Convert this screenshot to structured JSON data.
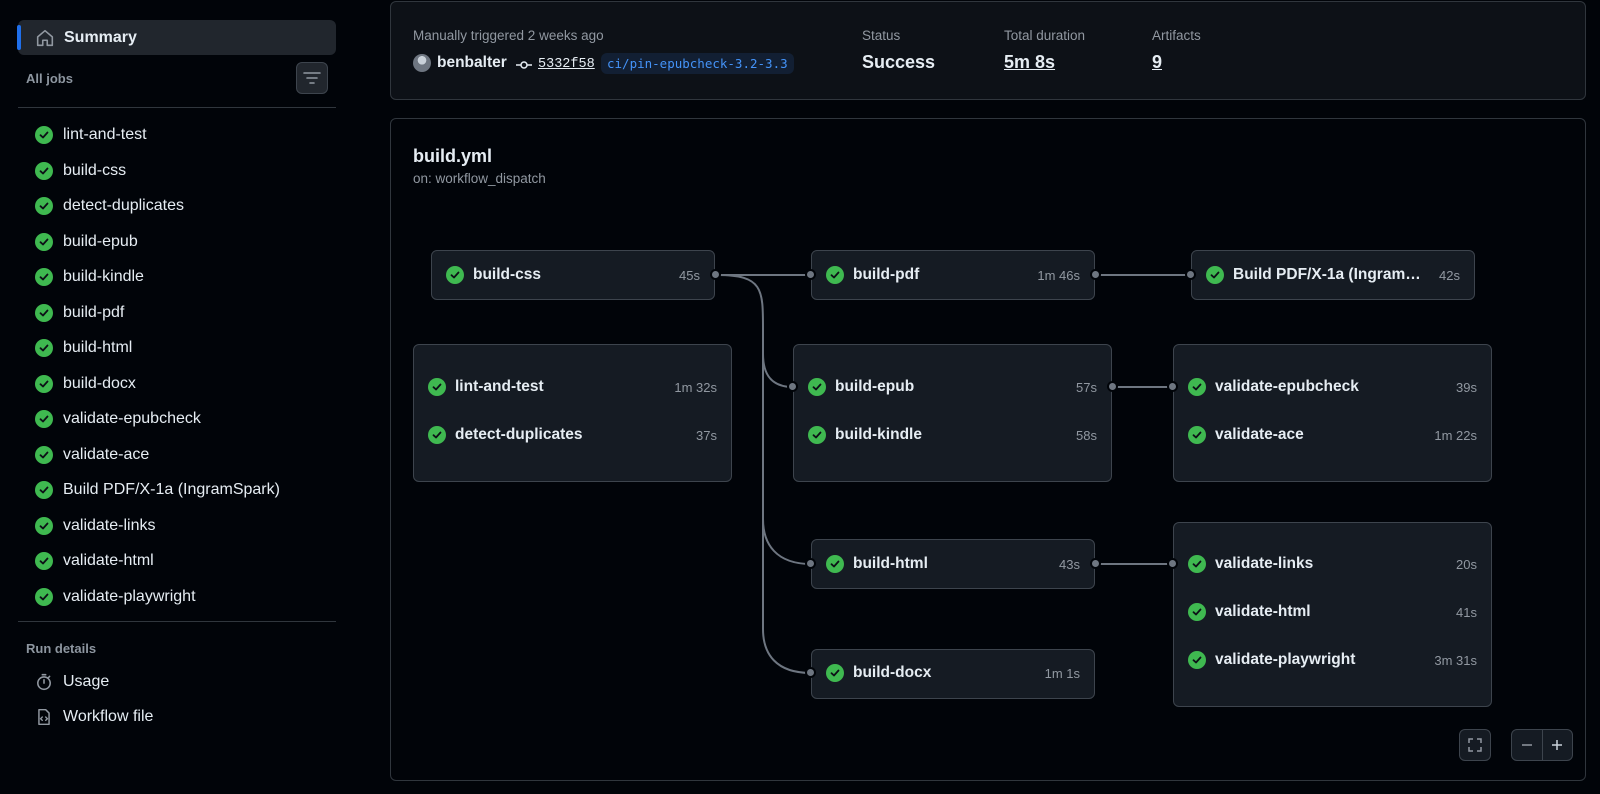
{
  "sidebar": {
    "summary_label": "Summary",
    "all_jobs_label": "All jobs",
    "jobs": [
      "lint-and-test",
      "build-css",
      "detect-duplicates",
      "build-epub",
      "build-kindle",
      "build-pdf",
      "build-html",
      "build-docx",
      "validate-epubcheck",
      "validate-ace",
      "Build PDF/X-1a (IngramSpark)",
      "validate-links",
      "validate-html",
      "validate-playwright"
    ],
    "run_details_label": "Run details",
    "usage_label": "Usage",
    "workflow_file_label": "Workflow file"
  },
  "header": {
    "trigger_text": "Manually triggered 2 weeks ago",
    "actor": "benbalter",
    "commit_sha": "5332f58",
    "branch": "ci/pin-epubcheck-3.2-3.3",
    "status_label": "Status",
    "status_value": "Success",
    "duration_label": "Total duration",
    "duration_value": "5m 8s",
    "artifacts_label": "Artifacts",
    "artifacts_value": "9"
  },
  "workflow": {
    "file": "build.yml",
    "trigger": "on: workflow_dispatch",
    "nodes": {
      "build_css": [
        {
          "name": "build-css",
          "duration": "45s"
        }
      ],
      "lint_group": [
        {
          "name": "lint-and-test",
          "duration": "1m 32s"
        },
        {
          "name": "detect-duplicates",
          "duration": "37s"
        }
      ],
      "build_pdf": [
        {
          "name": "build-pdf",
          "duration": "1m 46s"
        }
      ],
      "epub_group": [
        {
          "name": "build-epub",
          "duration": "57s"
        },
        {
          "name": "build-kindle",
          "duration": "58s"
        }
      ],
      "build_html": [
        {
          "name": "build-html",
          "duration": "43s"
        }
      ],
      "build_docx": [
        {
          "name": "build-docx",
          "duration": "1m 1s"
        }
      ],
      "pdfx": [
        {
          "name": "Build PDF/X-1a (IngramSpark)",
          "duration": "42s"
        }
      ],
      "validate_epub_group": [
        {
          "name": "validate-epubcheck",
          "duration": "39s"
        },
        {
          "name": "validate-ace",
          "duration": "1m 22s"
        }
      ],
      "validate_html_group": [
        {
          "name": "validate-links",
          "duration": "20s"
        },
        {
          "name": "validate-html",
          "duration": "41s"
        },
        {
          "name": "validate-playwright",
          "duration": "3m 31s"
        }
      ]
    }
  },
  "colors": {
    "success": "#3fb950",
    "accent": "#1f6feb",
    "branch": "#4493f8"
  },
  "icons": {
    "summary": "home-icon",
    "filter": "filter-icon",
    "job_status": "check-circle-icon",
    "commit": "git-commit-icon",
    "usage": "stopwatch-icon",
    "workflow_file": "file-code-icon",
    "fullscreen": "fullscreen-icon",
    "zoom_out": "zoom-out-icon",
    "zoom_in": "zoom-in-icon"
  }
}
